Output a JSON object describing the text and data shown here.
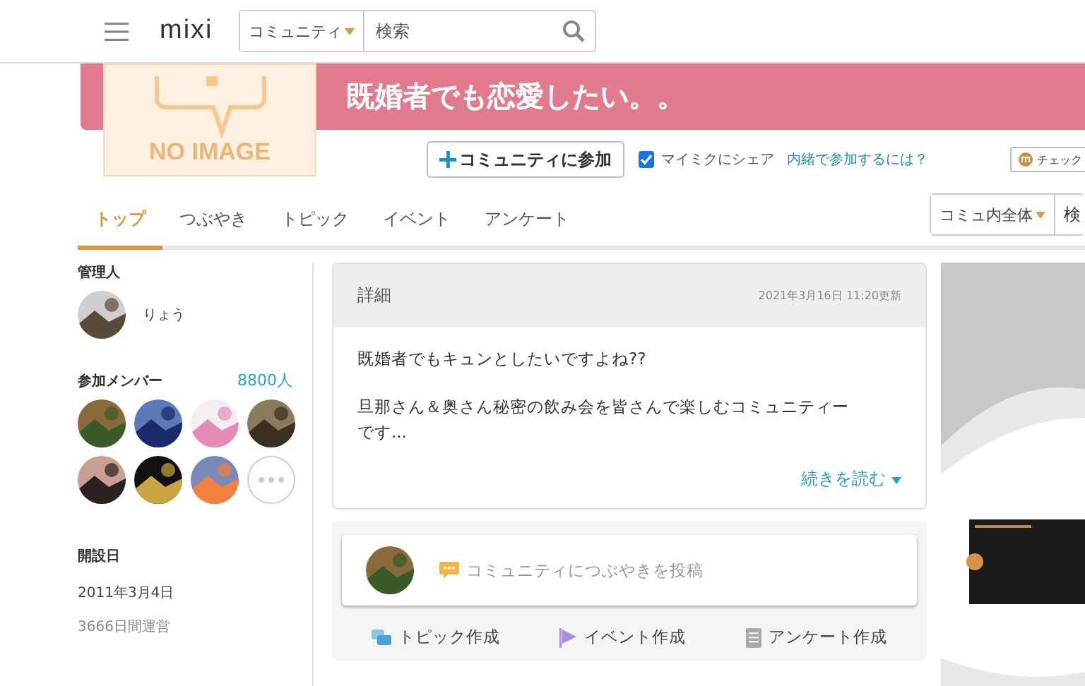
{
  "header": {
    "logo": "mixi",
    "search_scope": "コミュニティ",
    "search": {
      "placeholder": "検索"
    }
  },
  "community": {
    "thumbnail_text": "NO IMAGE",
    "title": "既婚者でも恋愛したい。。",
    "join_button": "コミュニティに参加",
    "share": {
      "label": "マイミクにシェア",
      "checked": true
    },
    "secret_link": "内緒で参加するには？",
    "check_button": "チェック"
  },
  "tabs": [
    {
      "label": "トップ",
      "selected": true
    },
    {
      "label": "つぶやき",
      "selected": false
    },
    {
      "label": "トピック",
      "selected": false
    },
    {
      "label": "イベント",
      "selected": false
    },
    {
      "label": "アンケート",
      "selected": false
    }
  ],
  "inner_search": {
    "scope": "コミュ内全体",
    "field": "検"
  },
  "sidebar": {
    "admin_heading": "管理人",
    "admin_name": "りょう",
    "members_heading": "参加メンバー",
    "member_count": "8800人",
    "members": [
      {
        "kind": "picture"
      },
      {
        "kind": "picture"
      },
      {
        "kind": "picture"
      },
      {
        "kind": "picture"
      },
      {
        "kind": "picture"
      },
      {
        "kind": "picture"
      },
      {
        "kind": "picture"
      },
      {
        "kind": "more"
      }
    ],
    "founded_heading": "開設日",
    "founded_date": "2011年3月4日",
    "running_days": "3666日間運営"
  },
  "detail": {
    "heading": "詳細",
    "updated": "2021年3月16日 11:20更新",
    "paragraphs": [
      "既婚者でもキュンとしたいですよね??",
      "旦那さん＆奥さん秘密の飲み会を皆さんで楽しむコミュニティーです..."
    ],
    "read_more": "続きを読む"
  },
  "composer": {
    "placeholder": "コミュニティにつぶやきを投稿",
    "actions": [
      {
        "kind": "topic",
        "label": "トピック作成"
      },
      {
        "kind": "event",
        "label": "イベント作成"
      },
      {
        "kind": "survey",
        "label": "アンケート作成"
      }
    ]
  }
}
